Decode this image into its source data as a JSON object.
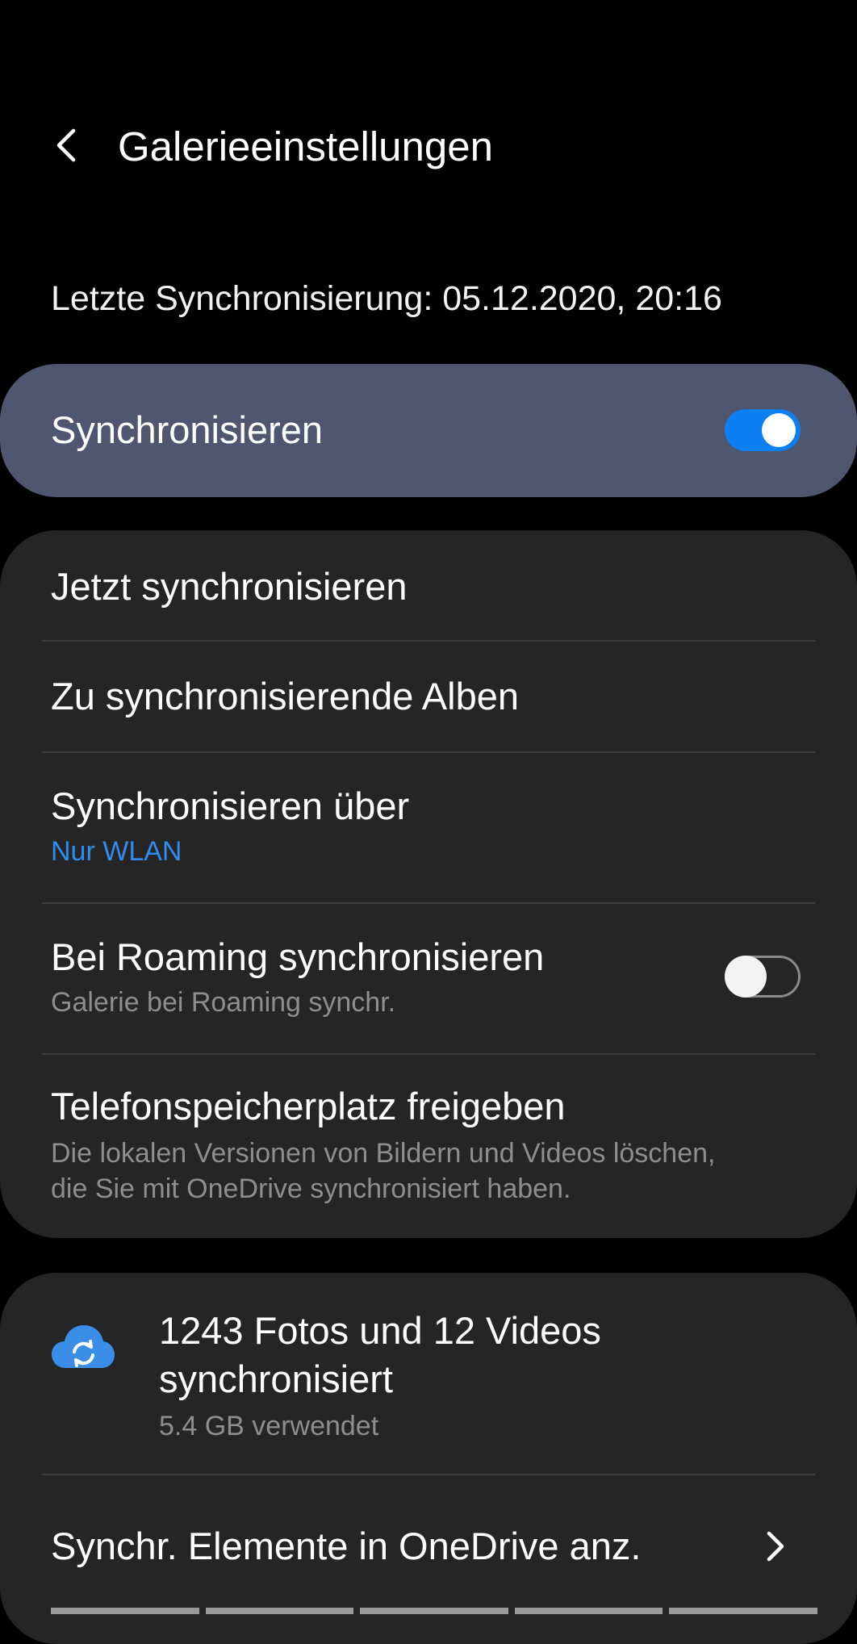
{
  "header": {
    "title": "Galerieeinstellungen",
    "back_icon": "chevron-left-icon"
  },
  "last_sync": "Letzte Synchronisierung: 05.12.2020, 20:16",
  "master_sync": {
    "label": "Synchronisieren",
    "enabled": true,
    "accent": "#0c7ff2"
  },
  "settings": {
    "sync_now": "Jetzt synchronisieren",
    "albums": "Zu synchronisierende Alben",
    "sync_via": {
      "title": "Synchronisieren über",
      "value": "Nur WLAN"
    },
    "roaming": {
      "title": "Bei Roaming synchronisieren",
      "subtitle": "Galerie bei Roaming synchr.",
      "enabled": false
    },
    "free_space": {
      "title": "Telefonspeicherplatz freigeben",
      "subtitle_line1": "Die lokalen Versionen von Bildern und Videos löschen,",
      "subtitle_line2": "die Sie mit OneDrive synchronisiert haben."
    }
  },
  "storage": {
    "icon": "cloud-sync-icon",
    "title": "1243 Fotos und 12 Videos synchronisiert",
    "usage": "5.4 GB verwendet",
    "view_link": "Synchr. Elemente in OneDrive anz.",
    "link_icon": "chevron-right-icon"
  },
  "colors": {
    "background": "#000000",
    "card": "#252525",
    "master_card": "#4f5670",
    "link_blue": "#2f8cf0"
  }
}
